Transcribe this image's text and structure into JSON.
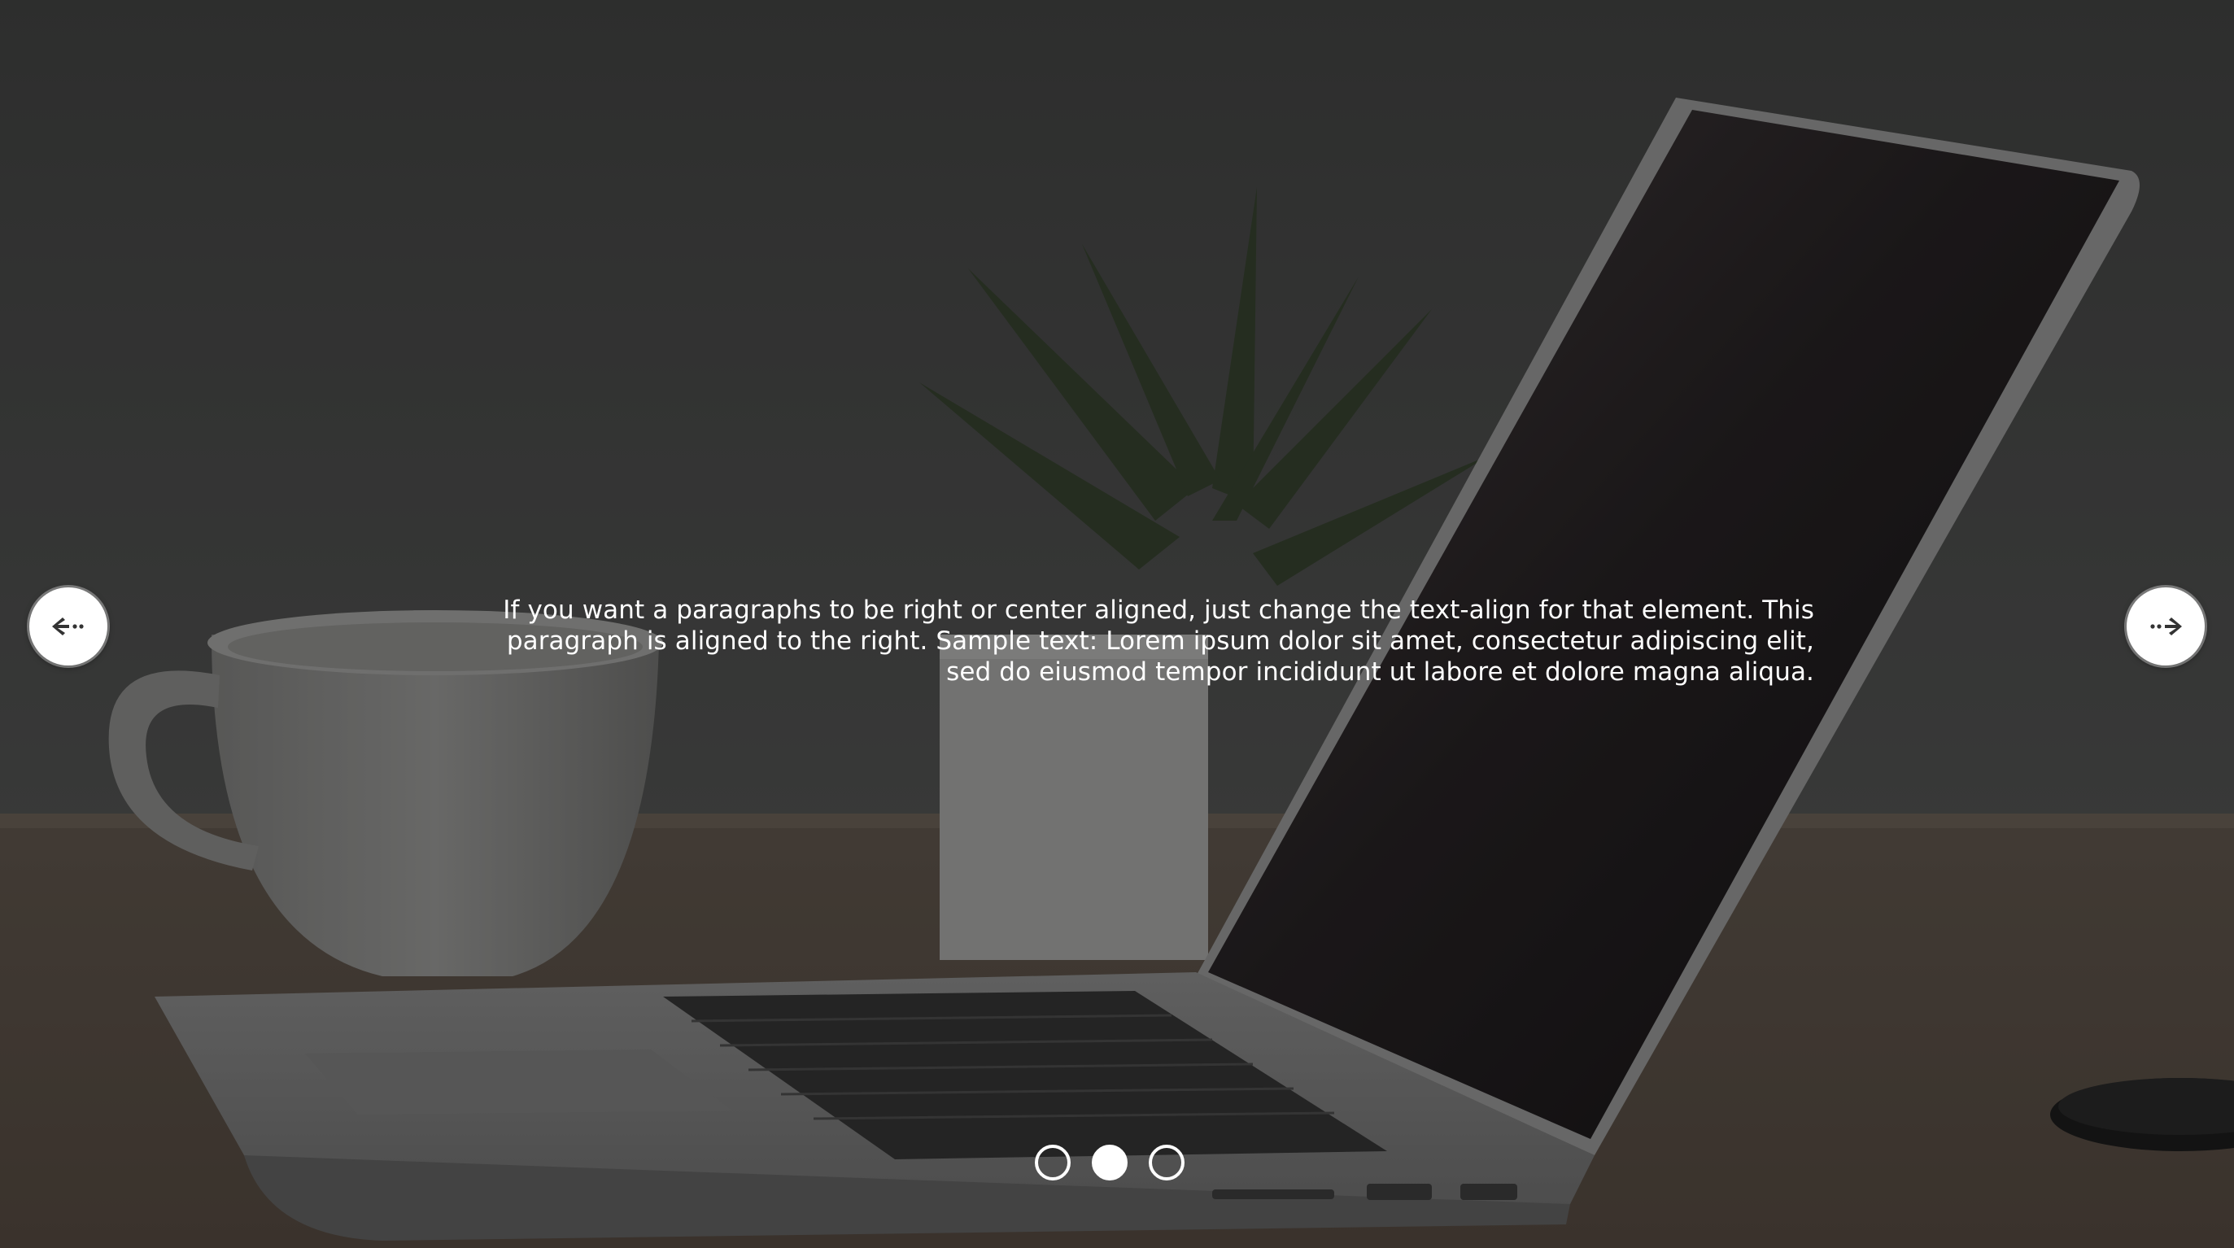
{
  "slide": {
    "caption": "If you want a paragraphs to be right or center aligned, just change the text-align for that element. This paragraph is aligned to the right. Sample text: Lorem ipsum dolor sit amet, consectetur adipiscing elit, sed do eiusmod tempor incididunt ut labore et dolore magna aliqua.",
    "background_description_icon": "laptop-desk-photo"
  },
  "navigation": {
    "prev_icon": "arrow-left-icon",
    "next_icon": "arrow-right-icon"
  },
  "pagination": {
    "total": 3,
    "active_index": 1
  },
  "colors": {
    "text": "#ffffff",
    "button_bg": "#ffffff",
    "arrow": "#333333"
  }
}
